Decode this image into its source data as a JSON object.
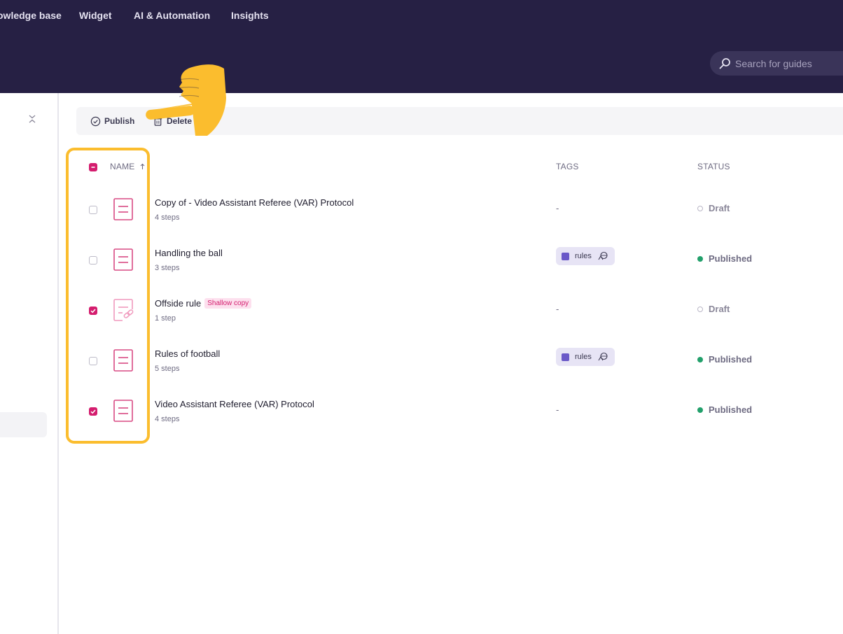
{
  "header": {
    "nav": [
      "owledge base",
      "Widget",
      "AI & Automation",
      "Insights"
    ],
    "search_placeholder": "Search for guides"
  },
  "toolbar": {
    "publish_label": "Publish",
    "delete_label": "Delete"
  },
  "table": {
    "columns": {
      "name": "NAME",
      "tags": "TAGS",
      "status": "STATUS"
    },
    "rows": [
      {
        "title": "Copy of - Video Assistant Referee (VAR) Protocol",
        "steps": "4 steps",
        "badge": "",
        "tag": "-",
        "status": "Draft",
        "checked": false,
        "icon": "document-icon"
      },
      {
        "title": "Handling the ball",
        "steps": "3 steps",
        "badge": "",
        "tag": "rules",
        "status": "Published",
        "checked": false,
        "icon": "document-icon"
      },
      {
        "title": "Offside rule",
        "steps": "1 step",
        "badge": "Shallow copy",
        "tag": "-",
        "status": "Draft",
        "checked": true,
        "icon": "linked-document-icon"
      },
      {
        "title": "Rules of football",
        "steps": "5 steps",
        "badge": "",
        "tag": "rules",
        "status": "Published",
        "checked": false,
        "icon": "document-icon"
      },
      {
        "title": "Video Assistant Referee (VAR) Protocol",
        "steps": "4 steps",
        "badge": "",
        "tag": "-",
        "status": "Published",
        "checked": true,
        "icon": "document-icon"
      }
    ]
  },
  "colors": {
    "header_bg": "#262044",
    "accent": "#d41d6e",
    "published": "#22a06b",
    "tag_square": "#6a58c8",
    "annotation": "#fbbd2e"
  }
}
